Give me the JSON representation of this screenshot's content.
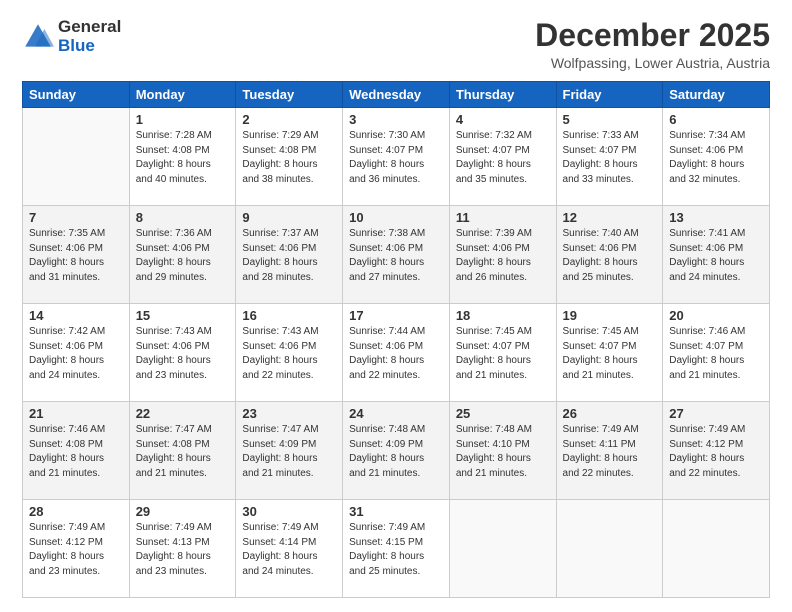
{
  "logo": {
    "general": "General",
    "blue": "Blue"
  },
  "header": {
    "month": "December 2025",
    "location": "Wolfpassing, Lower Austria, Austria"
  },
  "days_of_week": [
    "Sunday",
    "Monday",
    "Tuesday",
    "Wednesday",
    "Thursday",
    "Friday",
    "Saturday"
  ],
  "weeks": [
    [
      {
        "day": "",
        "info": ""
      },
      {
        "day": "1",
        "info": "Sunrise: 7:28 AM\nSunset: 4:08 PM\nDaylight: 8 hours\nand 40 minutes."
      },
      {
        "day": "2",
        "info": "Sunrise: 7:29 AM\nSunset: 4:08 PM\nDaylight: 8 hours\nand 38 minutes."
      },
      {
        "day": "3",
        "info": "Sunrise: 7:30 AM\nSunset: 4:07 PM\nDaylight: 8 hours\nand 36 minutes."
      },
      {
        "day": "4",
        "info": "Sunrise: 7:32 AM\nSunset: 4:07 PM\nDaylight: 8 hours\nand 35 minutes."
      },
      {
        "day": "5",
        "info": "Sunrise: 7:33 AM\nSunset: 4:07 PM\nDaylight: 8 hours\nand 33 minutes."
      },
      {
        "day": "6",
        "info": "Sunrise: 7:34 AM\nSunset: 4:06 PM\nDaylight: 8 hours\nand 32 minutes."
      }
    ],
    [
      {
        "day": "7",
        "info": "Sunrise: 7:35 AM\nSunset: 4:06 PM\nDaylight: 8 hours\nand 31 minutes."
      },
      {
        "day": "8",
        "info": "Sunrise: 7:36 AM\nSunset: 4:06 PM\nDaylight: 8 hours\nand 29 minutes."
      },
      {
        "day": "9",
        "info": "Sunrise: 7:37 AM\nSunset: 4:06 PM\nDaylight: 8 hours\nand 28 minutes."
      },
      {
        "day": "10",
        "info": "Sunrise: 7:38 AM\nSunset: 4:06 PM\nDaylight: 8 hours\nand 27 minutes."
      },
      {
        "day": "11",
        "info": "Sunrise: 7:39 AM\nSunset: 4:06 PM\nDaylight: 8 hours\nand 26 minutes."
      },
      {
        "day": "12",
        "info": "Sunrise: 7:40 AM\nSunset: 4:06 PM\nDaylight: 8 hours\nand 25 minutes."
      },
      {
        "day": "13",
        "info": "Sunrise: 7:41 AM\nSunset: 4:06 PM\nDaylight: 8 hours\nand 24 minutes."
      }
    ],
    [
      {
        "day": "14",
        "info": "Sunrise: 7:42 AM\nSunset: 4:06 PM\nDaylight: 8 hours\nand 24 minutes."
      },
      {
        "day": "15",
        "info": "Sunrise: 7:43 AM\nSunset: 4:06 PM\nDaylight: 8 hours\nand 23 minutes."
      },
      {
        "day": "16",
        "info": "Sunrise: 7:43 AM\nSunset: 4:06 PM\nDaylight: 8 hours\nand 22 minutes."
      },
      {
        "day": "17",
        "info": "Sunrise: 7:44 AM\nSunset: 4:06 PM\nDaylight: 8 hours\nand 22 minutes."
      },
      {
        "day": "18",
        "info": "Sunrise: 7:45 AM\nSunset: 4:07 PM\nDaylight: 8 hours\nand 21 minutes."
      },
      {
        "day": "19",
        "info": "Sunrise: 7:45 AM\nSunset: 4:07 PM\nDaylight: 8 hours\nand 21 minutes."
      },
      {
        "day": "20",
        "info": "Sunrise: 7:46 AM\nSunset: 4:07 PM\nDaylight: 8 hours\nand 21 minutes."
      }
    ],
    [
      {
        "day": "21",
        "info": "Sunrise: 7:46 AM\nSunset: 4:08 PM\nDaylight: 8 hours\nand 21 minutes."
      },
      {
        "day": "22",
        "info": "Sunrise: 7:47 AM\nSunset: 4:08 PM\nDaylight: 8 hours\nand 21 minutes."
      },
      {
        "day": "23",
        "info": "Sunrise: 7:47 AM\nSunset: 4:09 PM\nDaylight: 8 hours\nand 21 minutes."
      },
      {
        "day": "24",
        "info": "Sunrise: 7:48 AM\nSunset: 4:09 PM\nDaylight: 8 hours\nand 21 minutes."
      },
      {
        "day": "25",
        "info": "Sunrise: 7:48 AM\nSunset: 4:10 PM\nDaylight: 8 hours\nand 21 minutes."
      },
      {
        "day": "26",
        "info": "Sunrise: 7:49 AM\nSunset: 4:11 PM\nDaylight: 8 hours\nand 22 minutes."
      },
      {
        "day": "27",
        "info": "Sunrise: 7:49 AM\nSunset: 4:12 PM\nDaylight: 8 hours\nand 22 minutes."
      }
    ],
    [
      {
        "day": "28",
        "info": "Sunrise: 7:49 AM\nSunset: 4:12 PM\nDaylight: 8 hours\nand 23 minutes."
      },
      {
        "day": "29",
        "info": "Sunrise: 7:49 AM\nSunset: 4:13 PM\nDaylight: 8 hours\nand 23 minutes."
      },
      {
        "day": "30",
        "info": "Sunrise: 7:49 AM\nSunset: 4:14 PM\nDaylight: 8 hours\nand 24 minutes."
      },
      {
        "day": "31",
        "info": "Sunrise: 7:49 AM\nSunset: 4:15 PM\nDaylight: 8 hours\nand 25 minutes."
      },
      {
        "day": "",
        "info": ""
      },
      {
        "day": "",
        "info": ""
      },
      {
        "day": "",
        "info": ""
      }
    ]
  ]
}
